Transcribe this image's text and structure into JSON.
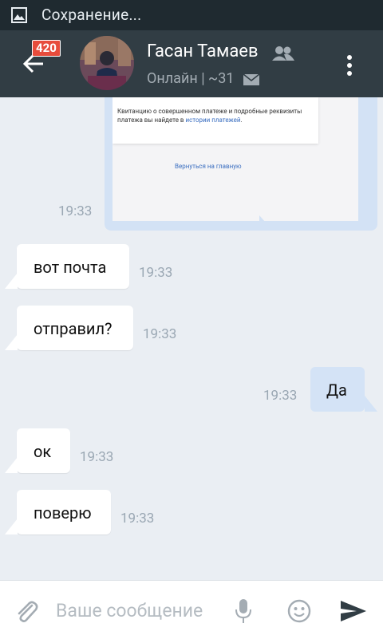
{
  "status_bar": {
    "text": "Сохранение...",
    "icon": "image-icon"
  },
  "header": {
    "title": "Гасан Тамаев",
    "subtitle": "Онлайн | ~31",
    "badge": "420",
    "icons": [
      "back-arrow-icon",
      "friends-icon",
      "mail-icon",
      "more-vert-icon"
    ]
  },
  "messages": {
    "photo": {
      "card_text": "Квитанцию о совершенном платеже и подробные реквизиты платежа вы найдете в ",
      "card_link": "истории платежей",
      "card_text_end": ".",
      "back_link": "Вернуться на главную",
      "time": "19:33"
    },
    "m1": {
      "text": "вот почта",
      "time": "19:33"
    },
    "m2": {
      "text": "отправил?",
      "time": "19:33"
    },
    "m3": {
      "text": "Да",
      "time": "19:33"
    },
    "m4": {
      "text": "ок",
      "time": "19:33"
    },
    "m5": {
      "text": "поверю",
      "time": "19:33"
    }
  },
  "composer": {
    "placeholder": "Ваше сообщение",
    "value": "",
    "icons": [
      "paperclip-icon",
      "mic-icon",
      "smile-icon",
      "send-icon"
    ]
  },
  "colors": {
    "header_bg": "#313d44",
    "status_bg": "#1f2a30",
    "chat_bg": "#eaeef3",
    "incoming_bubble": "#ffffff",
    "outgoing_bubble": "#d4e3f6",
    "badge": "#e74c3c",
    "time_text": "#9aa7b3"
  }
}
